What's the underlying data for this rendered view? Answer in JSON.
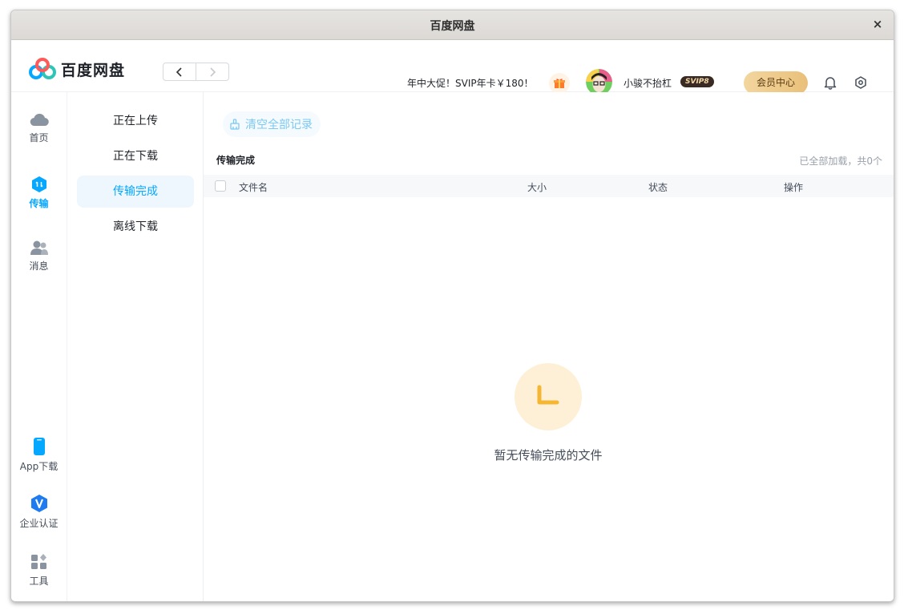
{
  "window": {
    "title": "百度网盘",
    "close_icon": "×"
  },
  "header": {
    "logo_text": "百度网盘",
    "promo_text": "年中大促！SVIP年卡￥180！",
    "username": "小骏不抬杠",
    "vip_badge": "SVIP8",
    "member_center_label": "会员中心"
  },
  "sidebar": {
    "items": [
      {
        "label": "首页",
        "icon": "cloud-icon"
      },
      {
        "label": "传输",
        "icon": "transfer-icon",
        "active": true
      },
      {
        "label": "消息",
        "icon": "users-icon"
      },
      {
        "label": "App下载",
        "icon": "phone-icon"
      },
      {
        "label": "企业认证",
        "icon": "enterprise-icon"
      },
      {
        "label": "工具",
        "icon": "tools-icon"
      }
    ]
  },
  "subnav": {
    "items": [
      {
        "label": "正在上传"
      },
      {
        "label": "正在下载"
      },
      {
        "label": "传输完成",
        "active": true
      },
      {
        "label": "离线下载"
      }
    ]
  },
  "main": {
    "clear_button_label": "清空全部记录",
    "section_title": "传输完成",
    "loaded_info": "已全部加载，共0个",
    "columns": [
      "文件名",
      "大小",
      "状态",
      "操作"
    ],
    "empty_text": "暂无传输完成的文件"
  },
  "colors": {
    "accent": "#06a7ff",
    "empty_icon_bg": "#fdf0d6",
    "empty_icon_fg": "#f5b731",
    "member_gold": "#e9c07a"
  }
}
